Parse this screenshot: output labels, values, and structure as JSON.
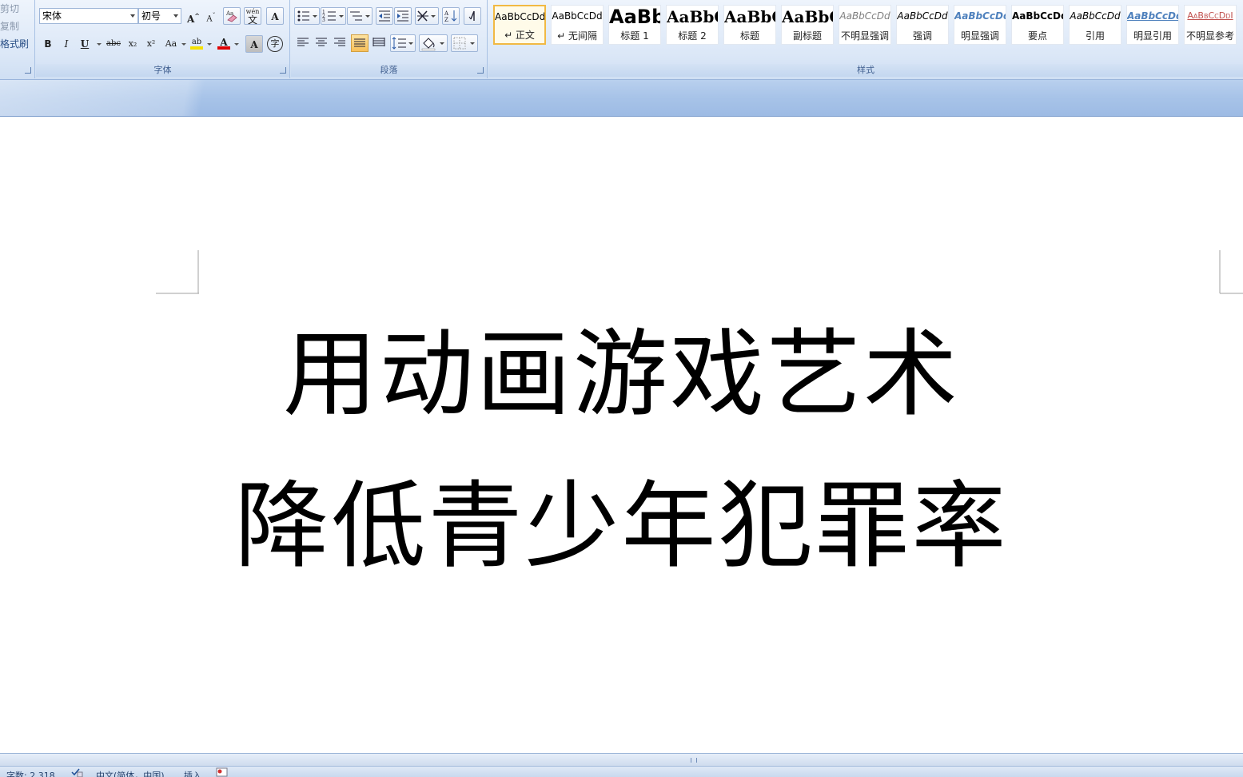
{
  "clipboard": {
    "cut_label": "剪切",
    "copy_label": "复制",
    "format_painter_label": "格式刷"
  },
  "font": {
    "group_label": "字体",
    "font_name": "宋体",
    "font_size": "初号",
    "grow_label": "A",
    "shrink_label": "A",
    "phonetic_label": "wén",
    "charborder_label": "A",
    "bold_label": "B",
    "italic_label": "I",
    "underline_label": "U",
    "strike_label": "abc",
    "subscript_label": "x₂",
    "superscript_label": "x²",
    "case_label": "Aa",
    "highlight_label": "ab",
    "fontcolor_label": "A",
    "shading_label": "A",
    "enclose_label": "字",
    "colors": {
      "highlight": "#f5e000",
      "font_color": "#e00000"
    }
  },
  "paragraph": {
    "group_label": "段落"
  },
  "styles": {
    "group_label": "样式",
    "items": [
      {
        "preview": "AaBbCcDd",
        "name": "↵ 正文"
      },
      {
        "preview": "AaBbCcDd",
        "name": "↵ 无间隔"
      },
      {
        "preview": "AaBb",
        "name": "标题 1"
      },
      {
        "preview": "AaBbC",
        "name": "标题 2"
      },
      {
        "preview": "AaBbC",
        "name": "标题"
      },
      {
        "preview": "AaBbC",
        "name": "副标题"
      },
      {
        "preview": "AaBbCcDd",
        "name": "不明显强调"
      },
      {
        "preview": "AaBbCcDd",
        "name": "强调"
      },
      {
        "preview": "AaBbCcDd",
        "name": "明显强调"
      },
      {
        "preview": "AaBbCcDd",
        "name": "要点"
      },
      {
        "preview": "AaBbCcDd",
        "name": "引用"
      },
      {
        "preview": "AaBbCcDd",
        "name": "明显引用"
      },
      {
        "preview": "AaBbCcDdI",
        "name": "不明显参考"
      }
    ],
    "selected_index": 0
  },
  "document": {
    "line1": "用动画游戏艺术",
    "line2": "降低青少年犯罪率"
  },
  "status": {
    "word_count": "字数: 2,318",
    "language": "中文(简体，中国)",
    "mode": "插入"
  }
}
